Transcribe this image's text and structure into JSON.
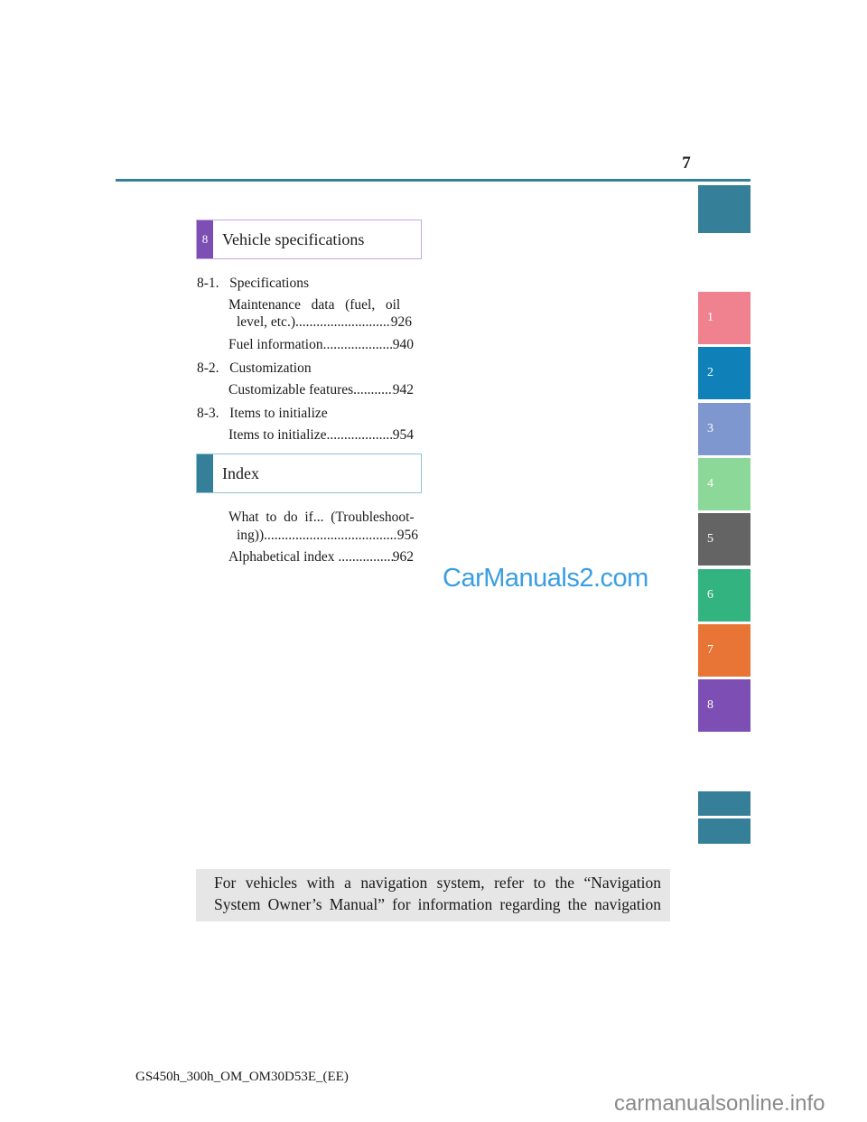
{
  "page_number": "7",
  "tabs": [
    {
      "label": "",
      "color": "#357f99"
    },
    {
      "label": "1",
      "color": "#f08290"
    },
    {
      "label": "2",
      "color": "#0f80b8"
    },
    {
      "label": "3",
      "color": "#7f97cf"
    },
    {
      "label": "4",
      "color": "#8cd898"
    },
    {
      "label": "5",
      "color": "#646464"
    },
    {
      "label": "6",
      "color": "#33b380"
    },
    {
      "label": "7",
      "color": "#e87535"
    },
    {
      "label": "8",
      "color": "#7d4fb5"
    },
    {
      "label": "",
      "color": "#357f99"
    },
    {
      "label": "",
      "color": "#357f99"
    }
  ],
  "sections": [
    {
      "number": "8",
      "title": "Vehicle specifications",
      "color": "#7d4fb5",
      "border": "#c4a8e0"
    },
    {
      "number": "",
      "title": "Index",
      "color": "#357f99",
      "border": "#8fc3d3"
    }
  ],
  "toc": {
    "s1": {
      "num": "8-1.",
      "title": "Specifications"
    },
    "e1a": "Maintenance   data   (fuel,   oil",
    "e1b": "level, etc.)",
    "p1": "926",
    "e2": "Fuel information",
    "p2": "940",
    "s2": {
      "num": "8-2.",
      "title": "Customization"
    },
    "e3": "Customizable features",
    "p3": "942",
    "s3": {
      "num": "8-3.",
      "title": "Items to initialize"
    },
    "e4": "Items to initialize",
    "p4": "954",
    "e5a": "What  to  do  if...  (Troubleshoot-",
    "e5b": "ing))",
    "p5": "956",
    "e6": "Alphabetical index ",
    "p6": "962"
  },
  "watermark": "CarManuals2.com",
  "note": "For vehicles with a navigation system, refer to the “Navigation System Owner’s Manual” for information regarding the navigation system.",
  "footer": "GS450h_300h_OM_OM30D53E_(EE)",
  "site_watermark": "carmanualsonline.info"
}
